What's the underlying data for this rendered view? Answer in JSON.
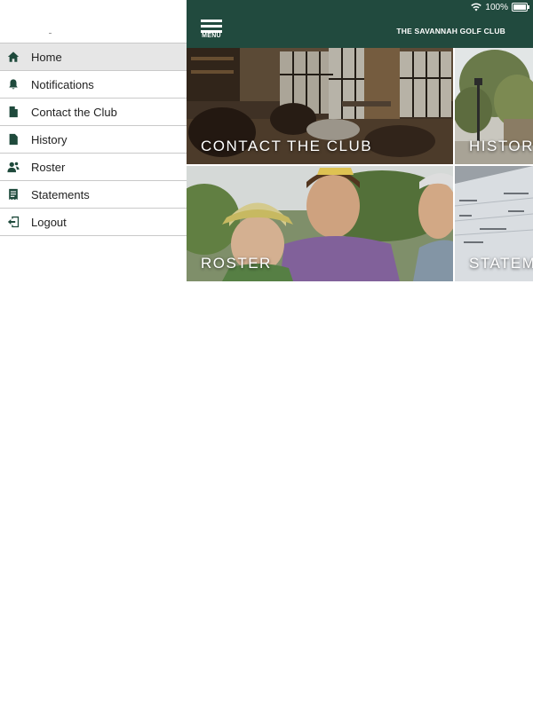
{
  "status_bar": {
    "battery_text": "100%"
  },
  "app_bar": {
    "menu_label": "MENU",
    "title": "THE SAVANNAH GOLF CLUB"
  },
  "drawer": {
    "items": [
      {
        "label": "Home",
        "icon": "home-icon",
        "active": true
      },
      {
        "label": "Notifications",
        "icon": "bell-icon"
      },
      {
        "label": "Contact the Club",
        "icon": "document-icon"
      },
      {
        "label": "History",
        "icon": "document-icon"
      },
      {
        "label": "Roster",
        "icon": "people-icon"
      },
      {
        "label": "Statements",
        "icon": "statement-icon"
      },
      {
        "label": "Logout",
        "icon": "logout-icon"
      }
    ]
  },
  "tiles": [
    {
      "label": "CONTACT THE CLUB"
    },
    {
      "label": "HISTORY"
    },
    {
      "label": "ROSTER"
    },
    {
      "label": "STATEMENTS"
    }
  ],
  "colors": {
    "brand_green": "#214a3e",
    "active_row": "#e6e6e6"
  }
}
